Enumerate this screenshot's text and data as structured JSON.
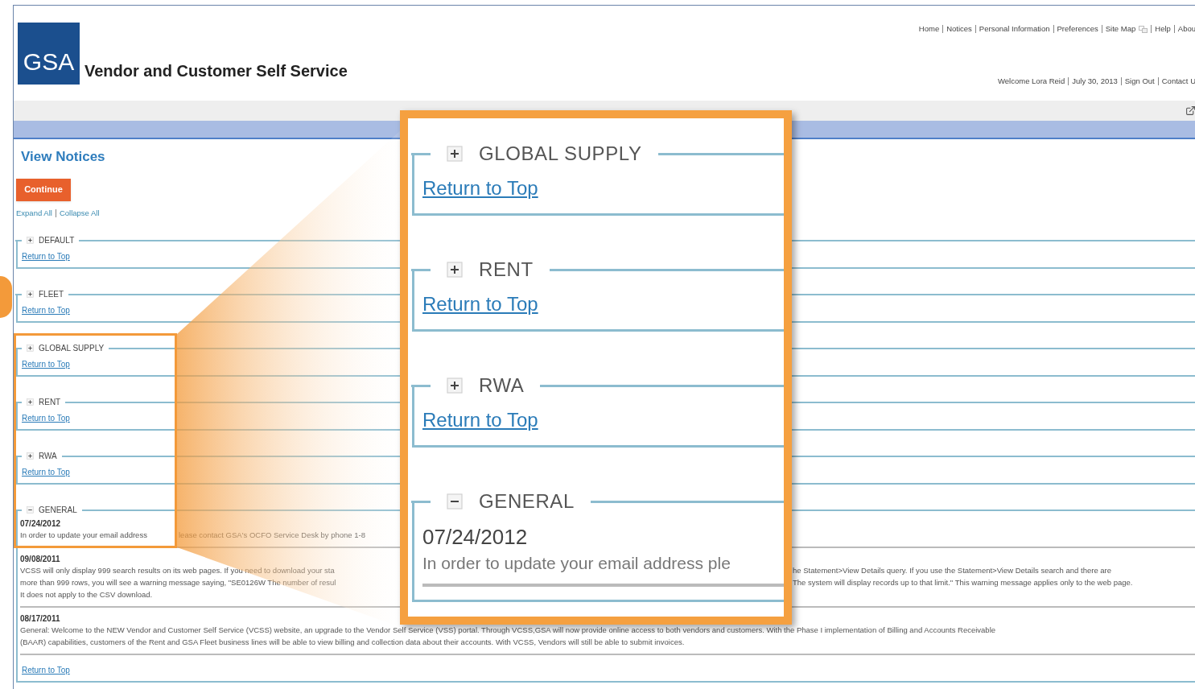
{
  "header": {
    "logo": "GSA",
    "title": "Vendor and Customer Self Service",
    "top_links": [
      "Home",
      "Notices",
      "Personal Information",
      "Preferences",
      "Site Map",
      "Help",
      "Abou"
    ],
    "user_links": [
      "Welcome Lora Reid",
      "July 30, 2013",
      "Sign Out",
      "Contact U"
    ]
  },
  "page_title": "View Notices",
  "continue_button": "Continue",
  "toggle_links": [
    "Expand All",
    "Collapse All"
  ],
  "sections": [
    {
      "label": "DEFAULT",
      "expanded": false,
      "link": "Return to Top"
    },
    {
      "label": "FLEET",
      "expanded": false,
      "link": "Return to Top"
    },
    {
      "label": "GLOBAL SUPPLY",
      "expanded": false,
      "link": "Return to Top"
    },
    {
      "label": "RENT",
      "expanded": false,
      "link": "Return to Top"
    },
    {
      "label": "RWA",
      "expanded": false,
      "link": "Return to Top"
    },
    {
      "label": "GENERAL",
      "expanded": true,
      "notices": [
        {
          "date": "07/24/2012",
          "lines": [
            {
              "left": "In order to update your email address",
              "middle": "lease contact GSA's OCFO Service Desk by phone 1-8"
            }
          ]
        },
        {
          "date": "09/08/2011",
          "lines": [
            {
              "left": "VCSS will only display 999 search results on its web pages. If you need to download your sta",
              "right": "he Statement>View Details query. If you use the Statement>View Details search and there are"
            },
            {
              "left": "more than 999 rows, you will see a warning message saying, \"SE0126W The number of resul",
              "right": "The system will display records up to that limit.\" This warning message applies only to the web page."
            },
            {
              "text": "It does not apply to the CSV download."
            }
          ]
        },
        {
          "date": "08/17/2011",
          "lines": [
            {
              "text": "General: Welcome to the NEW Vendor and Customer Self Service (VCSS) website, an upgrade to the Vendor Self Service (VSS) portal. Through VCSS,GSA will now provide online access to both vendors and customers. With the Phase I implementation of Billing and Accounts Receivable"
            },
            {
              "text": "(BAAR) capabilities, customers of the Rent and GSA Fleet business lines will be able to view billing and collection data about their accounts. With VCSS, Vendors will still be able to submit invoices."
            }
          ]
        }
      ],
      "link": "Return to Top"
    }
  ],
  "callout": {
    "sections": [
      {
        "label": "GLOBAL SUPPLY",
        "expanded": false,
        "link": "Return to Top"
      },
      {
        "label": "RENT",
        "expanded": false,
        "link": "Return to Top"
      },
      {
        "label": "RWA",
        "expanded": false,
        "link": "Return to Top"
      },
      {
        "label": "GENERAL",
        "expanded": true,
        "date": "07/24/2012",
        "text": "In order to update your email address ple"
      }
    ]
  }
}
